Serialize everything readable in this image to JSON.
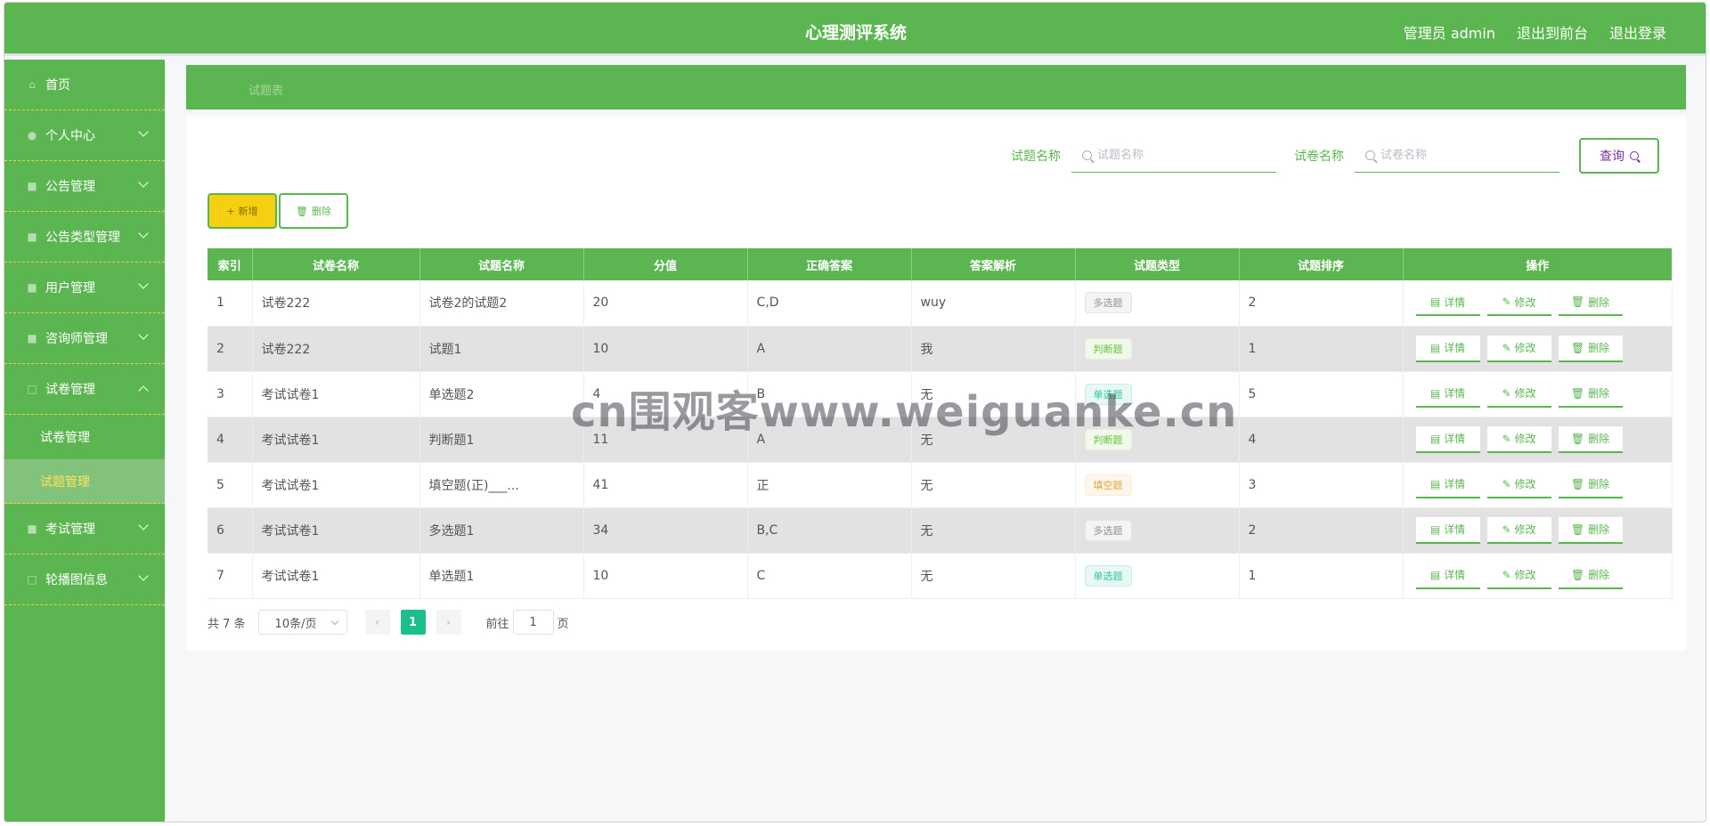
{
  "header": {
    "title": "心理测评系统",
    "user": "管理员 admin",
    "to_front": "退出到前台",
    "logout": "退出登录"
  },
  "sidebar": {
    "items": [
      {
        "label": "首页",
        "icon": "home-icon",
        "chevron": ""
      },
      {
        "label": "个人中心",
        "icon": "user-icon",
        "chevron": "down"
      },
      {
        "label": "公告管理",
        "icon": "notice-icon",
        "chevron": "down"
      },
      {
        "label": "公告类型管理",
        "icon": "notice-type-icon",
        "chevron": "down"
      },
      {
        "label": "用户管理",
        "icon": "users-icon",
        "chevron": "down"
      },
      {
        "label": "咨询师管理",
        "icon": "counselor-icon",
        "chevron": "down"
      },
      {
        "label": "试卷管理",
        "icon": "paper-icon",
        "chevron": "up"
      }
    ],
    "sub_items": [
      {
        "label": "试卷管理"
      },
      {
        "label": "试题管理"
      }
    ],
    "items_after": [
      {
        "label": "考试管理",
        "icon": "exam-icon",
        "chevron": "down"
      },
      {
        "label": "轮播图信息",
        "icon": "carousel-icon",
        "chevron": "down"
      }
    ]
  },
  "breadcrumb": "试题表",
  "search": {
    "field1_label": "试题名称",
    "field1_placeholder": "试题名称",
    "field2_label": "试卷名称",
    "field2_placeholder": "试卷名称",
    "query_label": "查询"
  },
  "actions": {
    "add_label": "新增",
    "delete_label": "删除"
  },
  "table": {
    "columns": [
      "索引",
      "试卷名称",
      "试题名称",
      "分值",
      "正确答案",
      "答案解析",
      "试题类型",
      "试题排序",
      "操作"
    ],
    "rows": [
      {
        "index": "1",
        "paper": "试卷222",
        "question": "试卷2的试题2",
        "score": "20",
        "answer": "C,D",
        "analysis": "wuy",
        "type": "多选题",
        "order": "2"
      },
      {
        "index": "2",
        "paper": "试卷222",
        "question": "试题1",
        "score": "10",
        "answer": "A",
        "analysis": "我",
        "type": "判断题",
        "order": "1"
      },
      {
        "index": "3",
        "paper": "考试试卷1",
        "question": "单选题2",
        "score": "4",
        "answer": "B",
        "analysis": "无",
        "type": "单选题",
        "order": "5"
      },
      {
        "index": "4",
        "paper": "考试试卷1",
        "question": "判断题1",
        "score": "11",
        "answer": "A",
        "analysis": "无",
        "type": "判断题",
        "order": "4"
      },
      {
        "index": "5",
        "paper": "考试试卷1",
        "question": "填空题(正)___...",
        "score": "41",
        "answer": "正",
        "analysis": "无",
        "type": "填空题",
        "order": "3"
      },
      {
        "index": "6",
        "paper": "考试试卷1",
        "question": "多选题1",
        "score": "34",
        "answer": "B,C",
        "analysis": "无",
        "type": "多选题",
        "order": "2"
      },
      {
        "index": "7",
        "paper": "考试试卷1",
        "question": "单选题1",
        "score": "10",
        "answer": "C",
        "analysis": "无",
        "type": "单选题",
        "order": "1"
      }
    ],
    "op_labels": {
      "detail": "详情",
      "edit": "修改",
      "delete": "删除"
    }
  },
  "pagination": {
    "total": "共 7 条",
    "page_size": "10条/页",
    "current_page": "1",
    "goto_prefix": "前往",
    "goto_value": "1",
    "goto_suffix": "页"
  },
  "watermark": "cn围观客www.weiguanke.cn",
  "colors": {
    "primary_green": "#5bb651",
    "add_yellow": "#f5cf11",
    "page_active": "#1cbf8c"
  }
}
